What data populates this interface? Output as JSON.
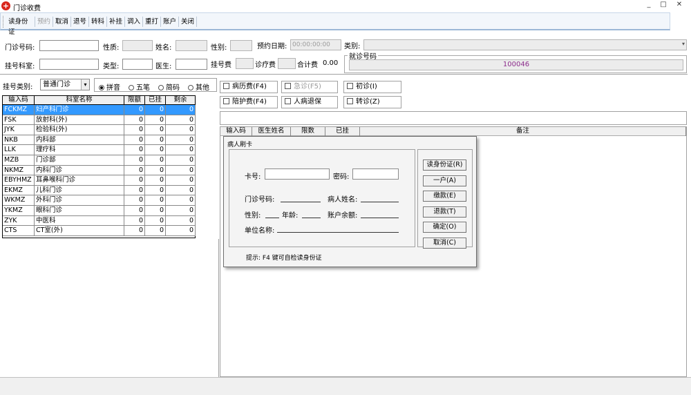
{
  "window": {
    "title": "门诊收费"
  },
  "toolbar": {
    "items": [
      {
        "label": "读身份证",
        "disabled": false
      },
      {
        "label": "预约",
        "disabled": true
      },
      {
        "label": "取消",
        "disabled": false
      },
      {
        "label": "退号",
        "disabled": false
      },
      {
        "label": "转科",
        "disabled": false
      },
      {
        "label": "补挂",
        "disabled": false
      },
      {
        "label": "调入",
        "disabled": false
      },
      {
        "label": "重打",
        "disabled": false
      },
      {
        "label": "账户",
        "disabled": false
      },
      {
        "label": "关闭",
        "disabled": false
      }
    ]
  },
  "form": {
    "clinic_no_label": "门诊号码:",
    "gender_label": "性质:",
    "name_label": "姓名:",
    "sex_label": "性别:",
    "appt_date_label": "预约日期:",
    "appt_date_value": "00:00:00:00",
    "category_label": "类别:",
    "dept_label": "挂号科室:",
    "type_label": "类型:",
    "doctor_label": "医生:",
    "reg_fee_label": "挂号费",
    "diag_fee_label": "诊疗费",
    "total_label": "合计费",
    "total_value": "0.00",
    "queue_label": "就诊号码",
    "queue_value": "100046"
  },
  "filter": {
    "label": "挂号类别:",
    "select_value": "普通门诊",
    "radios": [
      {
        "label": "拼音",
        "checked": true
      },
      {
        "label": "五笔",
        "checked": false
      },
      {
        "label": "简码",
        "checked": false
      },
      {
        "label": "其他",
        "checked": false
      }
    ]
  },
  "dept_table": {
    "headers": [
      "输入码",
      "科室名称",
      "限额",
      "已挂",
      "剩余"
    ],
    "rows": [
      [
        "FCKMZ",
        "妇产科门诊",
        "0",
        "0",
        "0"
      ],
      [
        "FSK",
        "放射科(外)",
        "0",
        "0",
        "0"
      ],
      [
        "JYK",
        "检验科(外)",
        "0",
        "0",
        "0"
      ],
      [
        "NKB",
        "内科部",
        "0",
        "0",
        "0"
      ],
      [
        "LLK",
        "理疗科",
        "0",
        "0",
        "0"
      ],
      [
        "MZB",
        "门诊部",
        "0",
        "0",
        "0"
      ],
      [
        "NKMZ",
        "内科门诊",
        "0",
        "0",
        "0"
      ],
      [
        "EBYHMZ",
        "耳鼻喉科门诊",
        "0",
        "0",
        "0"
      ],
      [
        "EKMZ",
        "儿科门诊",
        "0",
        "0",
        "0"
      ],
      [
        "WKMZ",
        "外科门诊",
        "0",
        "0",
        "0"
      ],
      [
        "YKMZ",
        "眼科门诊",
        "0",
        "0",
        "0"
      ],
      [
        "ZYK",
        "中医科",
        "0",
        "0",
        "0"
      ],
      [
        "CTS",
        "CT室(外)",
        "0",
        "0",
        "0"
      ]
    ]
  },
  "options": {
    "row1": [
      {
        "label": "病历费(F4)",
        "disabled": false
      },
      {
        "label": "急诊(F5)",
        "disabled": true
      },
      {
        "label": "初诊(I)",
        "disabled": false
      }
    ],
    "row2": [
      {
        "label": "陪护费(F4)",
        "disabled": false
      },
      {
        "label": "人病退保",
        "disabled": false
      },
      {
        "label": "转诊(Z)",
        "disabled": false
      }
    ]
  },
  "right_table": {
    "headers": [
      "输入码",
      "医生姓名",
      "限数",
      "已挂",
      "备注"
    ]
  },
  "dialog": {
    "title": "病人刷卡",
    "card_label": "卡号:",
    "password_label": "密码:",
    "clinic_no_label": "门诊号码:",
    "patient_name_label": "病人姓名:",
    "sex_label": "性别:",
    "age_label": "年龄:",
    "balance_label": "账户余额:",
    "employer_label": "单位名称:",
    "buttons": [
      "读身份证(R)",
      "一户(A)",
      "缴款(E)",
      "退款(T)",
      "确定(O)",
      "取消(C)"
    ],
    "hint": "提示: F4 键可自检读身份证"
  }
}
